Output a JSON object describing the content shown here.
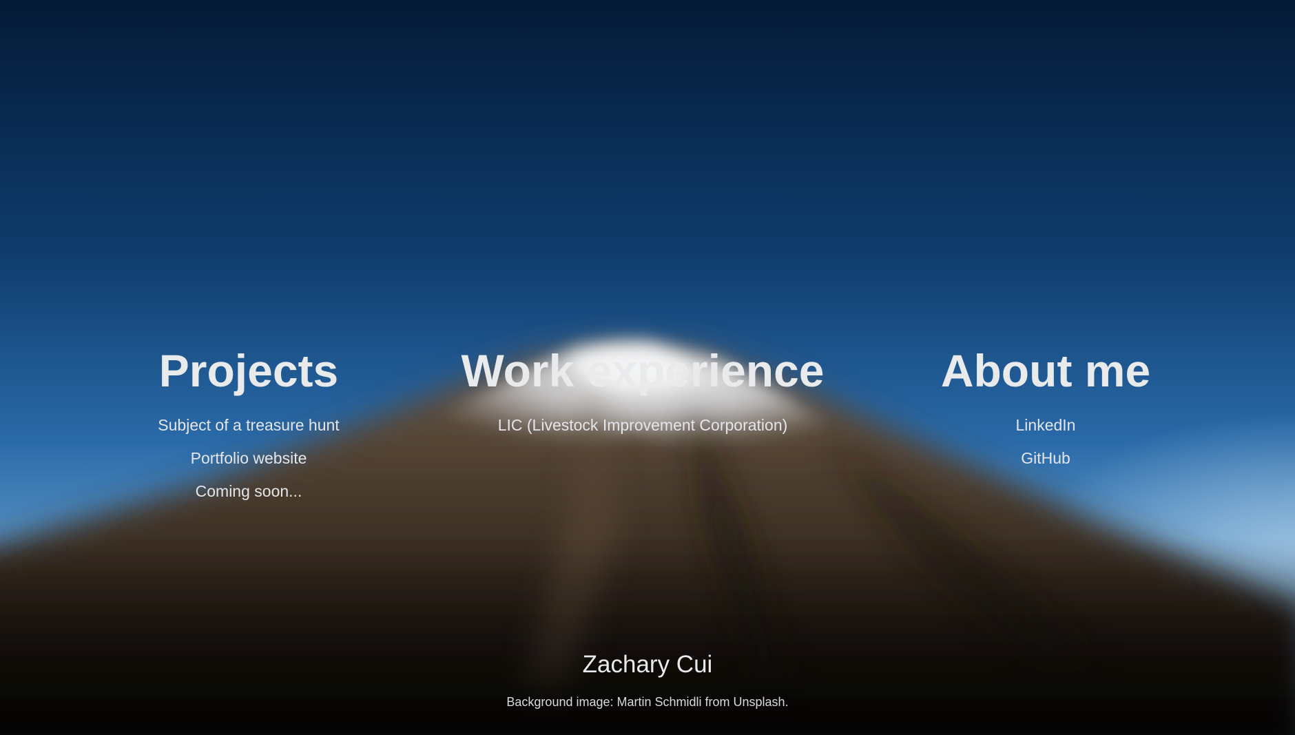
{
  "projects": {
    "heading": "Projects",
    "items": [
      "Subject of a treasure hunt",
      "Portfolio website",
      "Coming soon..."
    ]
  },
  "work": {
    "heading": "Work experience",
    "items": [
      "LIC (Livestock Improvement Corporation)"
    ]
  },
  "about": {
    "heading": "About me",
    "items": [
      "LinkedIn",
      "GitHub"
    ]
  },
  "footer": {
    "name": "Zachary Cui",
    "credit": "Background image: Martin Schmidli from Unsplash."
  },
  "colors": {
    "sky_top": "#041a36",
    "sky_mid": "#1d5794",
    "sky_horizon": "#7eb0d8",
    "snow": "#f2f2f0",
    "mountain": "#3e3125",
    "text": "#e9eaec"
  }
}
